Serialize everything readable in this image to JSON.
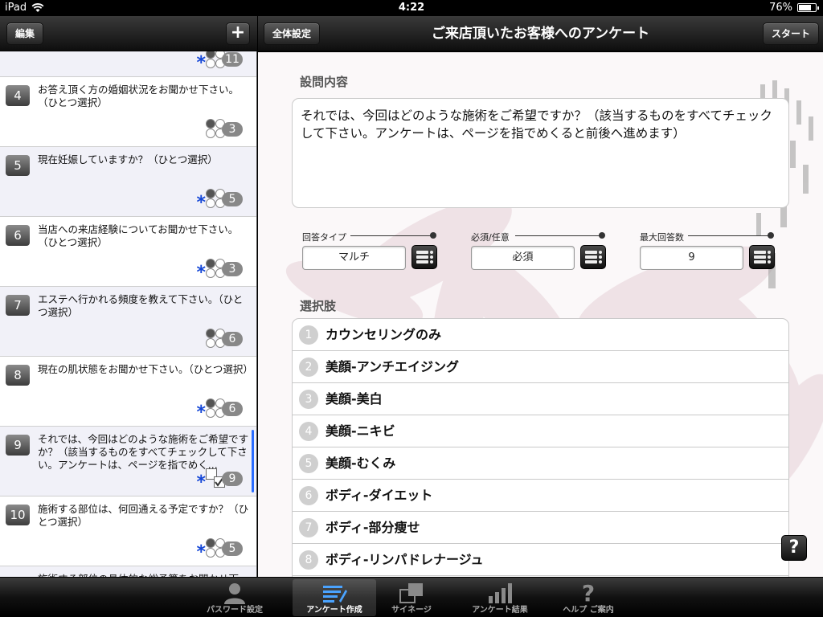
{
  "status_bar": {
    "device": "iPad",
    "time": "4:22",
    "battery": "76%",
    "battery_level": 0.76
  },
  "left_nav": {
    "edit_label": "編集",
    "add_label": "+"
  },
  "right_nav": {
    "settings_label": "全体設定",
    "title": "ご来店頂いたお客様へのアンケート",
    "start_label": "スタート"
  },
  "questions": [
    {
      "num": "",
      "text": "",
      "count": "11",
      "required": true,
      "kind": "radio"
    },
    {
      "num": "4",
      "text": "お答え頂く方の婚姻状況をお聞かせ下さい。（ひとつ選択）",
      "count": "3",
      "required": false,
      "kind": "radio"
    },
    {
      "num": "5",
      "text": "現在妊娠していますか？（ひとつ選択）",
      "count": "5",
      "required": true,
      "kind": "radio"
    },
    {
      "num": "6",
      "text": "当店への来店経験についてお聞かせ下さい。（ひとつ選択）",
      "count": "3",
      "required": true,
      "kind": "radio"
    },
    {
      "num": "7",
      "text": "エステへ行かれる頻度を教えて下さい。（ひとつ選択）",
      "count": "6",
      "required": false,
      "kind": "radio"
    },
    {
      "num": "8",
      "text": "現在の肌状態をお聞かせ下さい。（ひとつ選択）",
      "count": "6",
      "required": true,
      "kind": "radio"
    },
    {
      "num": "9",
      "text": "それでは、今回はどのような施術をご希望ですか？（該当するものをすべてチェックして下さい。アンケートは、ページを指でめく...",
      "count": "9",
      "required": true,
      "kind": "check"
    },
    {
      "num": "10",
      "text": "施術する部位は、何回通える予定ですか？（ひとつ選択）",
      "count": "5",
      "required": true,
      "kind": "radio"
    },
    {
      "num": "",
      "text": "施術する部位の具体的な総予算をお聞かせ下",
      "count": "",
      "required": false,
      "kind": "radio"
    }
  ],
  "detail": {
    "question_label": "設問内容",
    "question_text": "それでは、今回はどのような施術をご希望ですか？（該当するものをすべてチェックして下さい。アンケートは、ページを指でめくると前後へ進めます）",
    "answer_type_label": "回答タイプ",
    "answer_type_value": "マルチ",
    "required_label": "必須/任意",
    "required_value": "必須",
    "max_label": "最大回答数",
    "max_value": "9",
    "choices_label": "選択肢",
    "choices": [
      {
        "num": "1",
        "text": "カウンセリングのみ"
      },
      {
        "num": "2",
        "text": "美顔-アンチエイジング"
      },
      {
        "num": "3",
        "text": "美顔-美白"
      },
      {
        "num": "4",
        "text": "美顔-ニキビ"
      },
      {
        "num": "5",
        "text": "美顔-むくみ"
      },
      {
        "num": "6",
        "text": "ボディ-ダイエット"
      },
      {
        "num": "7",
        "text": "ボディ-部分痩せ"
      },
      {
        "num": "8",
        "text": "ボディ-リンパドレナージュ"
      }
    ],
    "help_label": "?"
  },
  "tabs": [
    {
      "label": "パスワード設定",
      "icon": "person-icon",
      "active": false
    },
    {
      "label": "アンケート作成",
      "icon": "edit-list-icon",
      "active": true
    },
    {
      "label": "サイネージ",
      "icon": "signage-icon",
      "active": false
    },
    {
      "label": "アンケート結果",
      "icon": "bar-chart-icon",
      "active": false
    },
    {
      "label": "ヘルプ ご案内",
      "icon": "help-icon",
      "active": false
    }
  ],
  "colors": {
    "accent_blue": "#1446d6",
    "selected_bar": "#2a6cff",
    "nav_dark": "#1a1a1a"
  }
}
